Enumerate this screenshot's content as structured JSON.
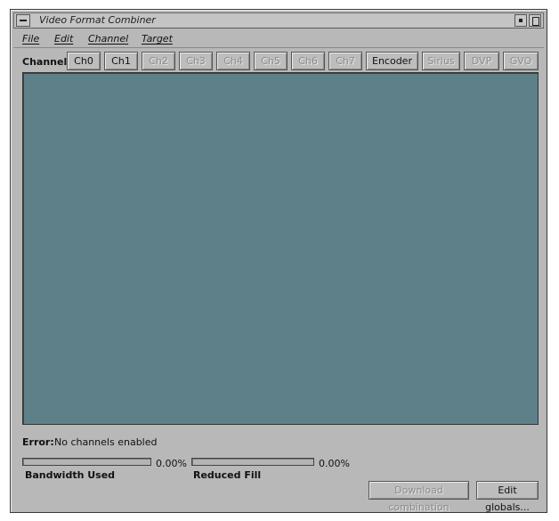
{
  "window": {
    "title": "Video Format Combiner"
  },
  "menubar": {
    "items": [
      "File",
      "Edit",
      "Channel",
      "Target"
    ]
  },
  "channels": {
    "label": "Channel:",
    "buttons": [
      {
        "label": "Ch0",
        "enabled": true
      },
      {
        "label": "Ch1",
        "enabled": true
      },
      {
        "label": "Ch2",
        "enabled": false
      },
      {
        "label": "Ch3",
        "enabled": false
      },
      {
        "label": "Ch4",
        "enabled": false
      },
      {
        "label": "Ch5",
        "enabled": false
      },
      {
        "label": "Ch6",
        "enabled": false
      },
      {
        "label": "Ch7",
        "enabled": false
      },
      {
        "label": "Encoder",
        "enabled": true
      },
      {
        "label": "Sirius",
        "enabled": false
      },
      {
        "label": "DVP",
        "enabled": false
      },
      {
        "label": "GVO",
        "enabled": false
      }
    ]
  },
  "canvas": {
    "background": "#5e8089"
  },
  "status": {
    "error_label": "Error:",
    "error_text": "No channels enabled",
    "bandwidth": {
      "label": "Bandwidth Used",
      "value": "0.00%",
      "fraction": 0.0
    },
    "reduced_fill": {
      "label": "Reduced Fill",
      "value": "0.00%",
      "fraction": 0.0
    }
  },
  "actions": {
    "download_label": "Download combination",
    "download_enabled": false,
    "edit_globals_label": "Edit globals..."
  },
  "icons": {
    "window_menu": "window-menu-icon",
    "minimize": "minimize-icon",
    "maximize": "maximize-icon"
  }
}
